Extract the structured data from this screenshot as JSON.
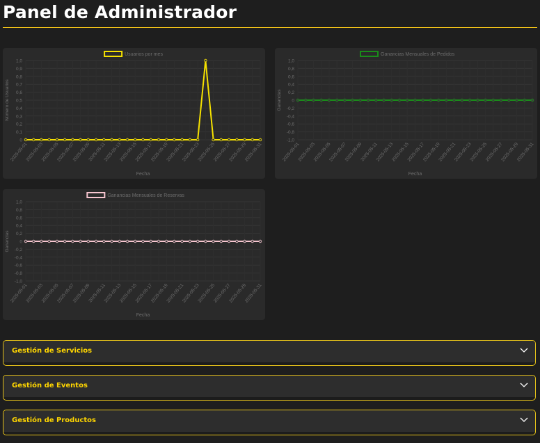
{
  "page": {
    "title": "Panel de Administrador"
  },
  "charts": [
    {
      "id": "usuarios",
      "type": "line",
      "legend": "Usuarios por mes",
      "ylabel": "Número de Usuarios",
      "xlabel": "Fecha",
      "color": "#f5e100",
      "ylim": [
        0,
        1.0
      ],
      "yticks": [
        "1,0",
        "0,9",
        "0,8",
        "0,7",
        "0,6",
        "0,5",
        "0,4",
        "0,3",
        "0,2",
        "0,1",
        "0"
      ]
    },
    {
      "id": "pedidos",
      "type": "line",
      "legend": "Ganancias Mensuales de Pedidos",
      "ylabel": "Ganancias",
      "xlabel": "Fecha",
      "color": "#1a8c1a",
      "ylim": [
        -1.0,
        1.0
      ],
      "yticks": [
        "1,0",
        "0,8",
        "0,6",
        "0,4",
        "0,2",
        "0",
        "-0,2",
        "-0,4",
        "-0,6",
        "-0,8",
        "-1,0"
      ]
    },
    {
      "id": "reservas",
      "type": "line",
      "legend": "Ganancias Mensuales de Reservas",
      "ylabel": "Ganancias",
      "xlabel": "Fecha",
      "color": "#f7c6d0",
      "ylim": [
        -1.0,
        1.0
      ],
      "yticks": [
        "1,0",
        "0,8",
        "0,6",
        "0,4",
        "0,2",
        "0",
        "-0,2",
        "-0,4",
        "-0,6",
        "-0,8",
        "-1,0"
      ]
    }
  ],
  "chart_data": [
    {
      "type": "line",
      "title": "",
      "xlabel": "Fecha",
      "ylabel": "Número de Usuarios",
      "ylim": [
        0,
        1.0
      ],
      "x": [
        "2025-05-01",
        "2025-05-02",
        "2025-05-03",
        "2025-05-04",
        "2025-05-05",
        "2025-05-06",
        "2025-05-07",
        "2025-05-08",
        "2025-05-09",
        "2025-05-10",
        "2025-05-11",
        "2025-05-12",
        "2025-05-13",
        "2025-05-14",
        "2025-05-15",
        "2025-05-16",
        "2025-05-17",
        "2025-05-18",
        "2025-05-19",
        "2025-05-20",
        "2025-05-21",
        "2025-05-22",
        "2025-05-23",
        "2025-05-24",
        "2025-05-25",
        "2025-05-26",
        "2025-05-27",
        "2025-05-28",
        "2025-05-29",
        "2025-05-30",
        "2025-05-31"
      ],
      "tick_labels": [
        "2025-05-01",
        "2025-05-03",
        "2025-05-05",
        "2025-05-07",
        "2025-05-09",
        "2025-05-11",
        "2025-05-13",
        "2025-05-15",
        "2025-05-17",
        "2025-05-19",
        "2025-05-21",
        "2025-05-23",
        "2025-05-25",
        "2025-05-27",
        "2025-05-29",
        "2025-05-31"
      ],
      "series": [
        {
          "name": "Usuarios por mes",
          "values": [
            0,
            0,
            0,
            0,
            0,
            0,
            0,
            0,
            0,
            0,
            0,
            0,
            0,
            0,
            0,
            0,
            0,
            0,
            0,
            0,
            0,
            0,
            0,
            1,
            0,
            0,
            0,
            0,
            0,
            0,
            0
          ]
        }
      ]
    },
    {
      "type": "line",
      "title": "",
      "xlabel": "Fecha",
      "ylabel": "Ganancias",
      "ylim": [
        -1.0,
        1.0
      ],
      "x": [
        "2025-05-01",
        "2025-05-02",
        "2025-05-03",
        "2025-05-04",
        "2025-05-05",
        "2025-05-06",
        "2025-05-07",
        "2025-05-08",
        "2025-05-09",
        "2025-05-10",
        "2025-05-11",
        "2025-05-12",
        "2025-05-13",
        "2025-05-14",
        "2025-05-15",
        "2025-05-16",
        "2025-05-17",
        "2025-05-18",
        "2025-05-19",
        "2025-05-20",
        "2025-05-21",
        "2025-05-22",
        "2025-05-23",
        "2025-05-24",
        "2025-05-25",
        "2025-05-26",
        "2025-05-27",
        "2025-05-28",
        "2025-05-29",
        "2025-05-30",
        "2025-05-31"
      ],
      "tick_labels": [
        "2025-05-01",
        "2025-05-03",
        "2025-05-05",
        "2025-05-07",
        "2025-05-09",
        "2025-05-11",
        "2025-05-13",
        "2025-05-15",
        "2025-05-17",
        "2025-05-19",
        "2025-05-21",
        "2025-05-23",
        "2025-05-25",
        "2025-05-27",
        "2025-05-29",
        "2025-05-31"
      ],
      "series": [
        {
          "name": "Ganancias Mensuales de Pedidos",
          "values": [
            0,
            0,
            0,
            0,
            0,
            0,
            0,
            0,
            0,
            0,
            0,
            0,
            0,
            0,
            0,
            0,
            0,
            0,
            0,
            0,
            0,
            0,
            0,
            0,
            0,
            0,
            0,
            0,
            0,
            0,
            0
          ]
        }
      ]
    },
    {
      "type": "line",
      "title": "",
      "xlabel": "Fecha",
      "ylabel": "Ganancias",
      "ylim": [
        -1.0,
        1.0
      ],
      "x": [
        "2025-05-01",
        "2025-05-02",
        "2025-05-03",
        "2025-05-04",
        "2025-05-05",
        "2025-05-06",
        "2025-05-07",
        "2025-05-08",
        "2025-05-09",
        "2025-05-10",
        "2025-05-11",
        "2025-05-12",
        "2025-05-13",
        "2025-05-14",
        "2025-05-15",
        "2025-05-16",
        "2025-05-17",
        "2025-05-18",
        "2025-05-19",
        "2025-05-20",
        "2025-05-21",
        "2025-05-22",
        "2025-05-23",
        "2025-05-24",
        "2025-05-25",
        "2025-05-26",
        "2025-05-27",
        "2025-05-28",
        "2025-05-29",
        "2025-05-30",
        "2025-05-31"
      ],
      "tick_labels": [
        "2025-05-01",
        "2025-05-03",
        "2025-05-05",
        "2025-05-07",
        "2025-05-09",
        "2025-05-11",
        "2025-05-13",
        "2025-05-15",
        "2025-05-17",
        "2025-05-19",
        "2025-05-21",
        "2025-05-23",
        "2025-05-25",
        "2025-05-27",
        "2025-05-29",
        "2025-05-31"
      ],
      "series": [
        {
          "name": "Ganancias Mensuales de Reservas",
          "values": [
            0,
            0,
            0,
            0,
            0,
            0,
            0,
            0,
            0,
            0,
            0,
            0,
            0,
            0,
            0,
            0,
            0,
            0,
            0,
            0,
            0,
            0,
            0,
            0,
            0,
            0,
            0,
            0,
            0,
            0,
            0
          ]
        }
      ]
    }
  ],
  "accordions": [
    {
      "label": "Gestión de Servicios",
      "icon": "chevron-down-icon"
    },
    {
      "label": "Gestión de Eventos",
      "icon": "chevron-down-icon"
    },
    {
      "label": "Gestión de Productos",
      "icon": "chevron-down-icon"
    }
  ],
  "colors": {
    "accent": "#f5c518",
    "accordion_title": "#ffd600",
    "card": "#2a2a2a",
    "background": "#1e1e1e"
  }
}
